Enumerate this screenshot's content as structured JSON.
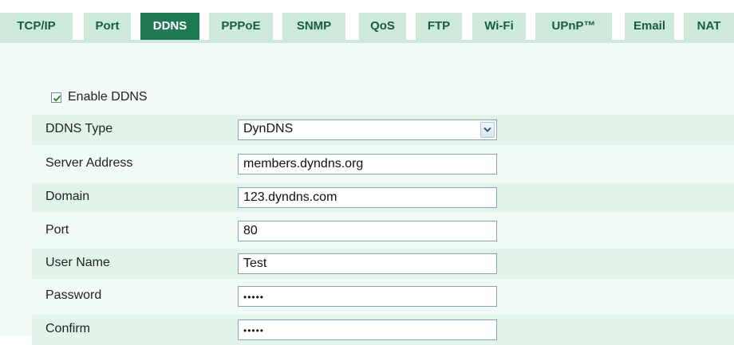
{
  "tabs": [
    {
      "label": "TCP/IP",
      "active": false
    },
    {
      "label": "Port",
      "active": false
    },
    {
      "label": "DDNS",
      "active": true
    },
    {
      "label": "PPPoE",
      "active": false
    },
    {
      "label": "SNMP",
      "active": false
    },
    {
      "label": "QoS",
      "active": false
    },
    {
      "label": "FTP",
      "active": false
    },
    {
      "label": "Wi-Fi",
      "active": false
    },
    {
      "label": "UPnP™",
      "active": false
    },
    {
      "label": "Email",
      "active": false
    },
    {
      "label": "NAT",
      "active": false
    }
  ],
  "enable_ddns": {
    "label": "Enable DDNS",
    "checked": true
  },
  "form": {
    "ddns_type": {
      "label": "DDNS Type",
      "value": "DynDNS"
    },
    "server_address": {
      "label": "Server Address",
      "value": "members.dyndns.org"
    },
    "domain": {
      "label": "Domain",
      "value": "123.dyndns.com"
    },
    "port": {
      "label": "Port",
      "value": "80"
    },
    "user_name": {
      "label": "User Name",
      "value": "Test"
    },
    "password": {
      "label": "Password",
      "value": "•••••"
    },
    "confirm": {
      "label": "Confirm",
      "value": "•••••"
    }
  },
  "colors": {
    "tab_bg": "#cde9da",
    "tab_active_bg": "#1f7a52",
    "tab_text": "#1a5c3f",
    "panel_bg": "#f1faf5",
    "row_stripe": "#e2f3ea",
    "checkmark": "#2e8b3e"
  }
}
